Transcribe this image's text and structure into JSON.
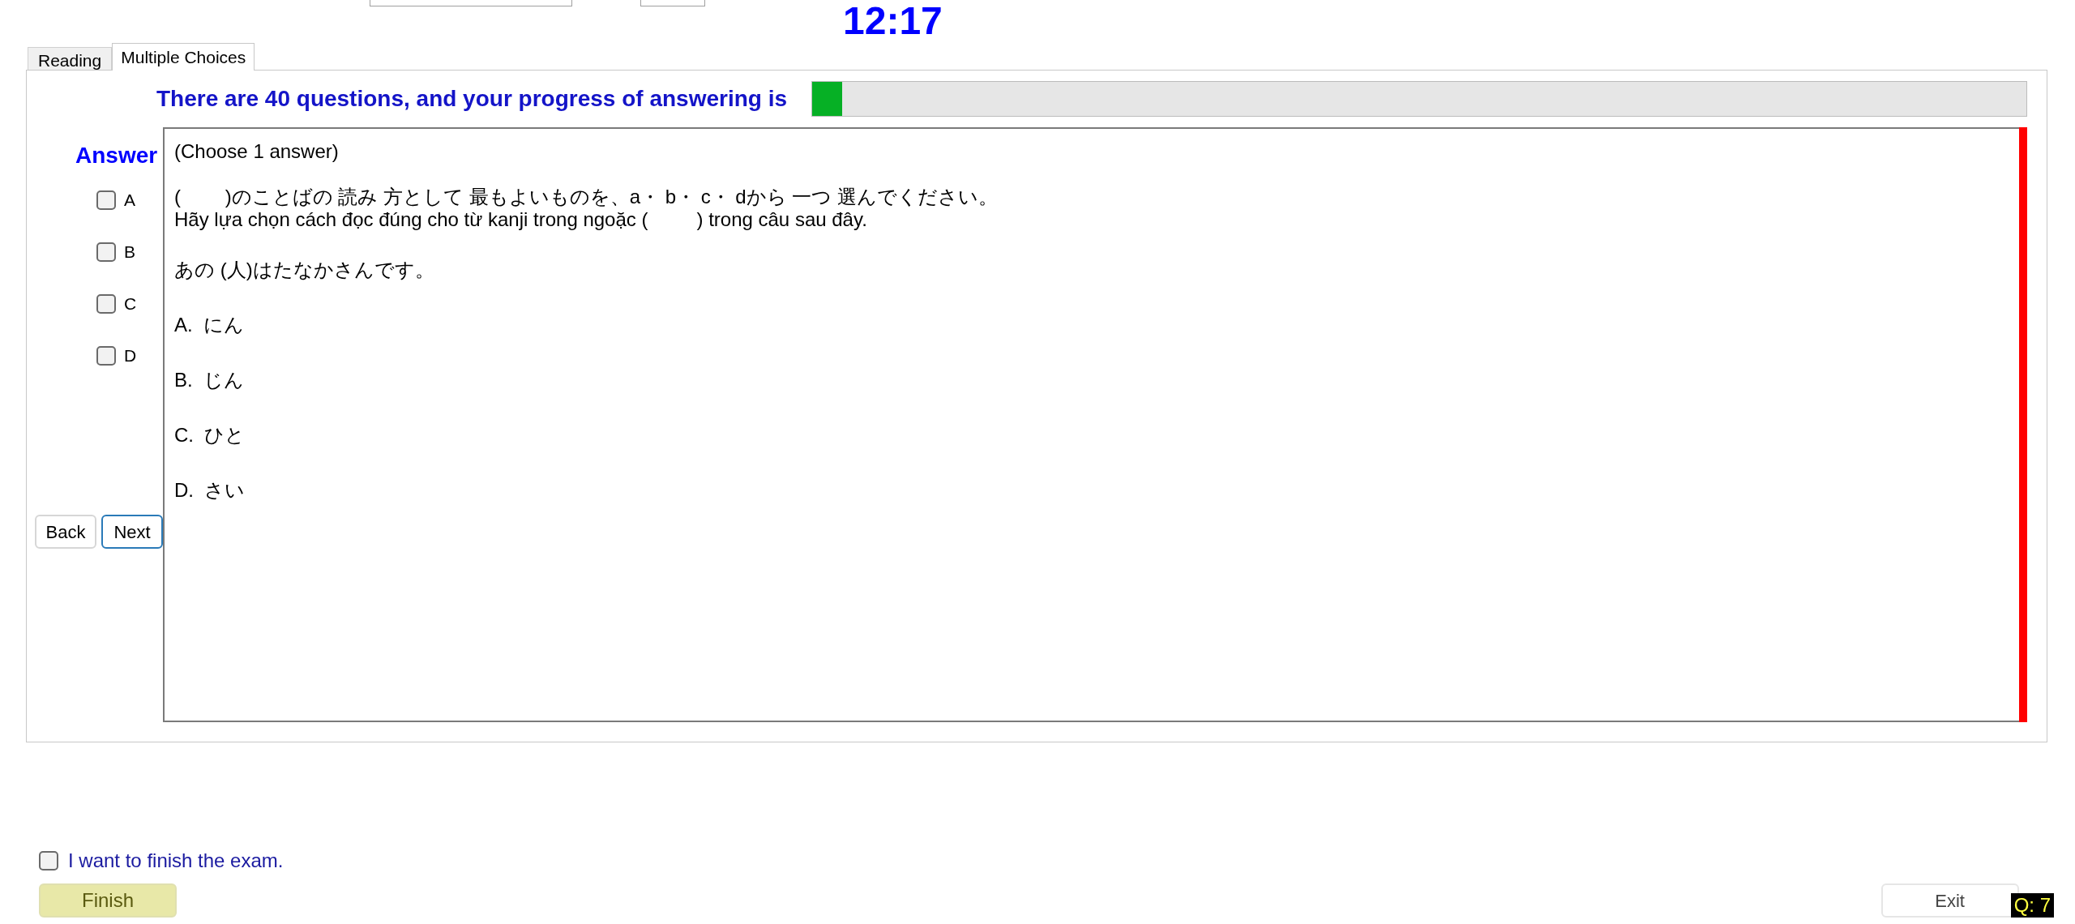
{
  "header": {
    "timer": "12:17"
  },
  "tabs": [
    {
      "label": "Reading",
      "selected": false
    },
    {
      "label": "Multiple Choices",
      "selected": true
    }
  ],
  "progress": {
    "label": "There are 40 questions, and your progress of answering is",
    "level": 0.025
  },
  "answer_panel": {
    "title": "Answer",
    "options": [
      {
        "label": "A",
        "checked": false
      },
      {
        "label": "B",
        "checked": false
      },
      {
        "label": "C",
        "checked": false
      },
      {
        "label": "D",
        "checked": false
      }
    ]
  },
  "nav_buttons": [
    {
      "label": "Back",
      "focused": false
    },
    {
      "label": "Next",
      "focused": true
    }
  ],
  "question": {
    "instruction": "(Choose 1 answer)",
    "prompt_lines": [
      "(　　 )のことばの 読み 方として 最もよいものを、a・ b・ c・ dから 一つ 選んでください。",
      "Hãy lựa chọn cách đọc đúng cho từ kanji trong ngoặc (         ) trong câu sau đây."
    ],
    "sentence": "あの (人)はたなかさんです。",
    "choices": [
      "A.  にん",
      "B.  じん",
      "C.  ひと",
      "D.  さい"
    ]
  },
  "finish": {
    "label": "I want to finish the exam.",
    "checked": false,
    "button": "Finish"
  },
  "exit_button": "Exit",
  "question_counter": "Q: 7"
}
